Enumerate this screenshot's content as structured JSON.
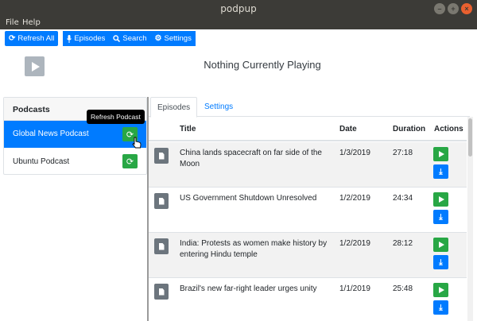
{
  "window": {
    "title": "podpup",
    "minimize": "–",
    "maximize": "+",
    "close": "×"
  },
  "menu": {
    "file": "File",
    "help": "Help"
  },
  "toolbar": {
    "refresh_all": "Refresh All",
    "episodes": "Episodes",
    "search": "Search",
    "settings": "Settings"
  },
  "player": {
    "status": "Nothing Currently Playing"
  },
  "podcasts": {
    "header": "Podcasts",
    "items": [
      {
        "name": "Global News Podcast",
        "active": true
      },
      {
        "name": "Ubuntu Podcast",
        "active": false
      }
    ],
    "tooltip": "Refresh Podcast"
  },
  "tabs": {
    "episodes": "Episodes",
    "settings": "Settings"
  },
  "table": {
    "headers": {
      "title": "Title",
      "date": "Date",
      "duration": "Duration",
      "actions": "Actions"
    },
    "rows": [
      {
        "title": "China lands spacecraft on far side of the Moon",
        "date": "1/3/2019",
        "duration": "27:18"
      },
      {
        "title": "US Government Shutdown Unresolved",
        "date": "1/2/2019",
        "duration": "24:34"
      },
      {
        "title": "India: Protests as women make history by entering Hindu temple",
        "date": "1/2/2019",
        "duration": "28:12"
      },
      {
        "title": "Brazil's new far-right leader urges unity",
        "date": "1/1/2019",
        "duration": "25:48"
      }
    ]
  },
  "colors": {
    "primary": "#007bff",
    "success": "#28a745",
    "secondary": "#6c757d",
    "titlebar": "#3c3b37"
  },
  "icons": {
    "refresh": "refresh-icon",
    "microphone": "microphone-icon",
    "search": "search-icon",
    "gear": "gear-icon",
    "play": "play-icon",
    "download": "download-icon",
    "document": "document-icon"
  }
}
